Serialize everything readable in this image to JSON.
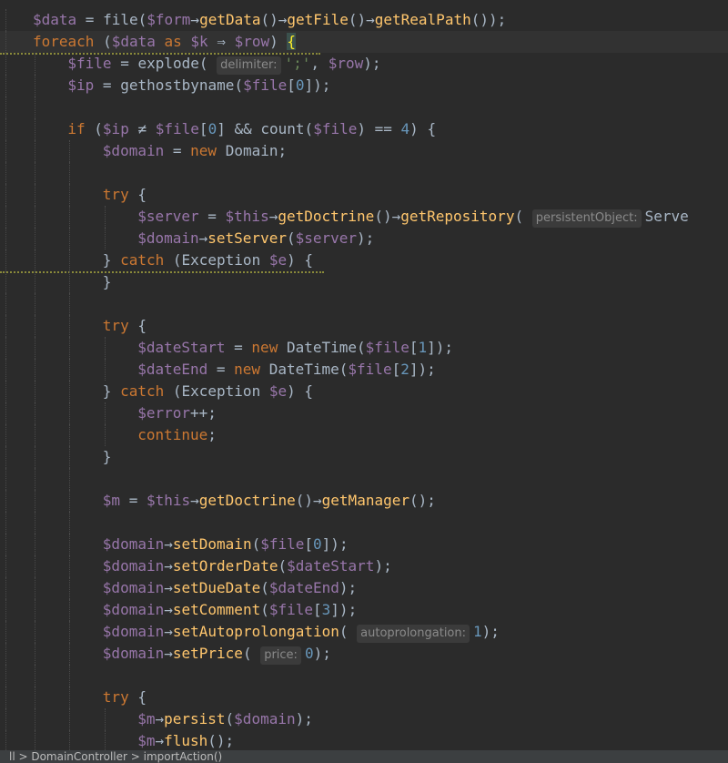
{
  "editor": {
    "tokens": {
      "data": "$data",
      "eq": " = ",
      "file_fn": "file",
      "form": "$form",
      "arrow": "→",
      "getData": "getData",
      "getFile": "getFile",
      "getRealPath": "getRealPath",
      "foreach": "foreach",
      "as": "as",
      "k": "$k",
      "fatarrow": "⇒",
      "row": "$row",
      "file_var": "$file",
      "explode": "explode",
      "delimiter_hint": "delimiter:",
      "semicolon_str": "';'",
      "ip": "$ip",
      "gethostbyname": "gethostbyname",
      "zero": "0",
      "if": "if",
      "neq": "≠",
      "and": "&&",
      "count": "count",
      "eqeq": "==",
      "four": "4",
      "domain": "$domain",
      "new": "new",
      "Domain": "Domain",
      "try": "try",
      "server": "$server",
      "this": "$this",
      "getDoctrine": "getDoctrine",
      "getRepository": "getRepository",
      "persistentObject_hint": "persistentObject:",
      "Serve": "Serve",
      "setServer": "setServer",
      "catch": "catch",
      "Exception": "Exception",
      "e": "$e",
      "dateStart": "$dateStart",
      "dateEnd": "$dateEnd",
      "DateTime": "DateTime",
      "one": "1",
      "two": "2",
      "three": "3",
      "error": "$error",
      "inc": "++",
      "continue": "continue",
      "m": "$m",
      "getManager": "getManager",
      "setDomain": "setDomain",
      "setOrderDate": "setOrderDate",
      "setDueDate": "setDueDate",
      "setComment": "setComment",
      "setAutoprolongation": "setAutoprolongation",
      "autoprolongation_hint": "autoprolongation:",
      "setPrice": "setPrice",
      "price_hint": "price:",
      "persist": "persist",
      "flush": "flush"
    }
  },
  "statusbar": {
    "text": "ll  >  DomainController  >  importAction()"
  }
}
